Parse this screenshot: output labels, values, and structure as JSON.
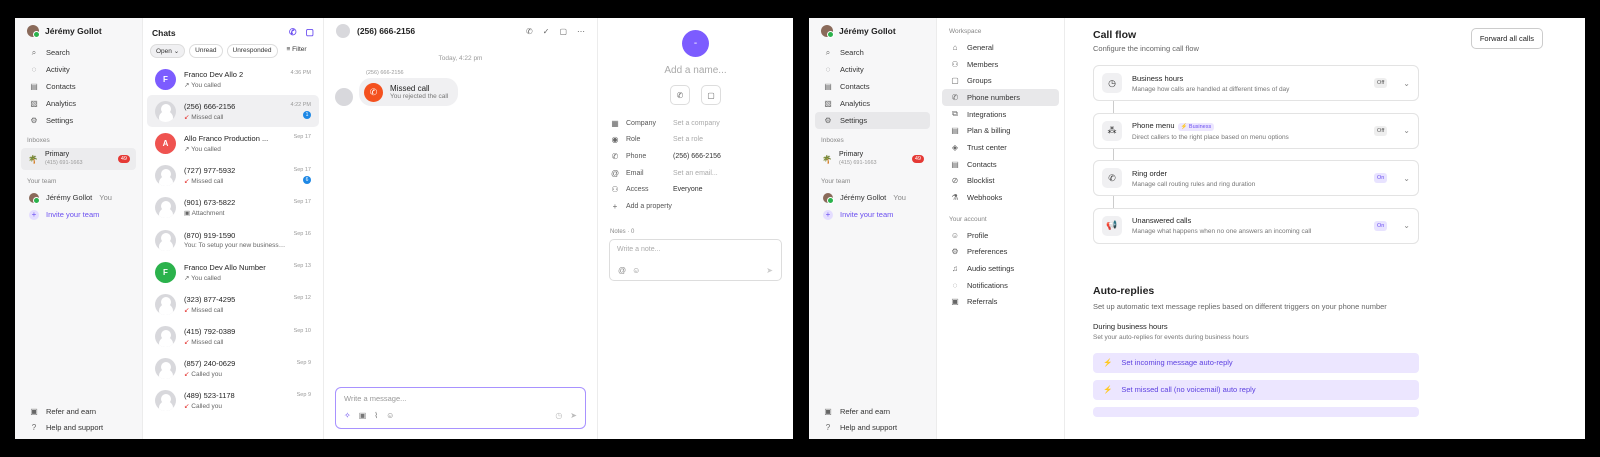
{
  "user": {
    "name": "Jérémy Gollot"
  },
  "nav": [
    "Search",
    "Activity",
    "Contacts",
    "Analytics",
    "Settings"
  ],
  "sidebar": {
    "inboxes_label": "Inboxes",
    "inbox_name": "Primary",
    "inbox_number": "(415) 691-1663",
    "inbox_badge": "49",
    "team_label": "Your team",
    "member_name": "Jérémy Gollot",
    "member_you": "You",
    "invite": "Invite your team",
    "refer": "Refer and earn",
    "help": "Help and support"
  },
  "chats": {
    "title": "Chats",
    "filters": {
      "open": "Open",
      "unread": "Unread",
      "unresponded": "Unresponded",
      "filter": "Filter"
    },
    "items": [
      {
        "initial": "F",
        "color": "#7c5cff",
        "name": "Franco Dev Allo 2",
        "sub": "You called",
        "arrow": "↗",
        "time": "4:36 PM",
        "count": ""
      },
      {
        "initial": "",
        "color": "",
        "name": "(256) 666-2156",
        "sub": "Missed call",
        "arrow": "↙",
        "time": "4:22 PM",
        "count": "1"
      },
      {
        "initial": "A",
        "color": "#ef5350",
        "name": "Allo Franco Production ...",
        "sub": "You called",
        "arrow": "↗",
        "time": "Sep 17",
        "count": ""
      },
      {
        "initial": "",
        "color": "",
        "name": "(727) 977-5932",
        "sub": "Missed call",
        "arrow": "↙",
        "time": "Sep 17",
        "count": "6"
      },
      {
        "initial": "",
        "color": "",
        "name": "(901) 673-5822",
        "sub": "Attachment",
        "arrow": "▣",
        "time": "Sep 17",
        "count": ""
      },
      {
        "initial": "",
        "color": "",
        "name": "(870) 919-1590",
        "sub": "You: To setup your new business pho...",
        "arrow": "",
        "time": "Sep 16",
        "count": ""
      },
      {
        "initial": "F",
        "color": "#2bb24c",
        "name": "Franco Dev Allo Number",
        "sub": "You called",
        "arrow": "↗",
        "time": "Sep 13",
        "count": ""
      },
      {
        "initial": "",
        "color": "",
        "name": "(323) 877-4295",
        "sub": "Missed call",
        "arrow": "↙",
        "time": "Sep 12",
        "count": ""
      },
      {
        "initial": "",
        "color": "",
        "name": "(415) 792-0389",
        "sub": "Missed call",
        "arrow": "↙",
        "time": "Sep 10",
        "count": ""
      },
      {
        "initial": "",
        "color": "",
        "name": "(857) 240-0629",
        "sub": "Called you",
        "arrow": "↙",
        "time": "Sep 9",
        "count": ""
      },
      {
        "initial": "",
        "color": "",
        "name": "(489) 523-1178",
        "sub": "Called you",
        "arrow": "↙",
        "time": "Sep 9",
        "count": ""
      }
    ]
  },
  "conversation": {
    "title": "(256) 666-2156",
    "day": "Today, 4:22 pm",
    "from": "(256) 666-2156",
    "msg_title": "Missed call",
    "msg_sub": "You rejected the call",
    "composer_placeholder": "Write a message..."
  },
  "contact": {
    "initial": "-",
    "name_placeholder": "Add a name...",
    "props": [
      {
        "icon": "▦",
        "key": "Company",
        "value": "Set a company",
        "dark": false
      },
      {
        "icon": "◉",
        "key": "Role",
        "value": "Set a role",
        "dark": false
      },
      {
        "icon": "✆",
        "key": "Phone",
        "value": "(256) 666-2156",
        "dark": true
      },
      {
        "icon": "@",
        "key": "Email",
        "value": "Set an email...",
        "dark": false
      },
      {
        "icon": "⚇",
        "key": "Access",
        "value": "Everyone",
        "dark": true
      }
    ],
    "add_property": "Add a property",
    "notes_label": "Notes · 0",
    "note_placeholder": "Write a note..."
  },
  "settings": {
    "workspace_label": "Workspace",
    "workspace_items": [
      "General",
      "Members",
      "Groups",
      "Phone numbers",
      "Integrations",
      "Plan & billing",
      "Trust center",
      "Contacts",
      "Blocklist",
      "Webhooks"
    ],
    "account_label": "Your account",
    "account_items": [
      "Profile",
      "Preferences",
      "Audio settings",
      "Notifications",
      "Referrals"
    ]
  },
  "callflow": {
    "title": "Call flow",
    "subtitle": "Configure the incoming call flow",
    "forward": "Forward all calls",
    "cards": [
      {
        "icon": "◷",
        "title": "Business hours",
        "desc": "Manage how calls are handled at different times of day",
        "state": "Off",
        "on": false,
        "badge": ""
      },
      {
        "icon": "⁂",
        "title": "Phone menu",
        "desc": "Direct callers to the right place based on menu options",
        "state": "Off",
        "on": false,
        "badge": "⚡ Business"
      },
      {
        "icon": "✆",
        "title": "Ring order",
        "desc": "Manage call routing rules and ring duration",
        "state": "On",
        "on": true,
        "badge": ""
      },
      {
        "icon": "📢",
        "title": "Unanswered calls",
        "desc": "Manage what happens when no one answers an incoming call",
        "state": "On",
        "on": true,
        "badge": ""
      }
    ]
  },
  "autoreplies": {
    "title": "Auto-replies",
    "subtitle": "Set up automatic text message replies based on different triggers on your phone number",
    "section": "During business hours",
    "section_sub": "Set your auto-replies for events during business hours",
    "items": [
      "Set incoming message auto-reply",
      "Set missed call (no voicemail) auto reply"
    ]
  },
  "colors": {
    "accent": "#6b4ff0",
    "missed": "#f4511e",
    "badge": "#e53935"
  }
}
